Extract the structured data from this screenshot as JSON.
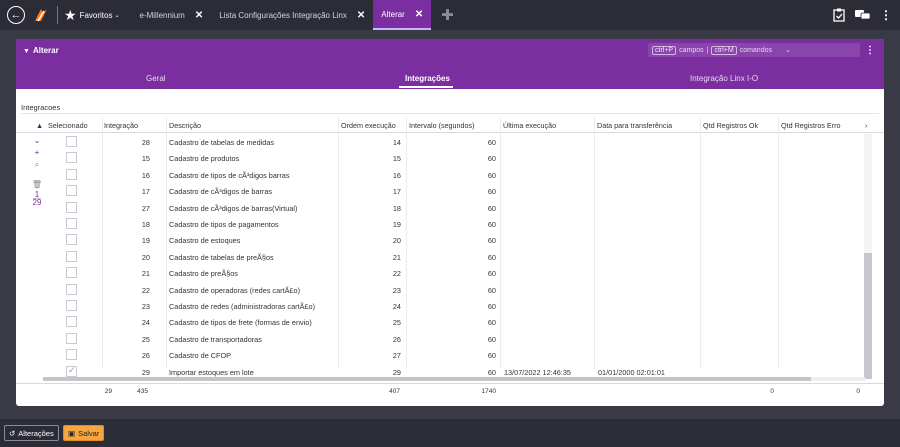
{
  "topbar": {
    "favorites_label": "Favoritos",
    "tabs": [
      {
        "label": "e-Millennium",
        "close": "✕"
      },
      {
        "label": "Lista Configurações Integração Linx",
        "close": "✕"
      },
      {
        "label": "Alterar",
        "close": "✕",
        "active": true
      }
    ]
  },
  "panel": {
    "title": "Alterar",
    "shortcut1_key": "ctrl+P",
    "shortcut1_label": "campos",
    "shortcut_separator": "|",
    "shortcut2_key": "ctrl+M",
    "shortcut2_label": "comandos",
    "tabs": [
      {
        "label": "Geral"
      },
      {
        "label": "Integrações",
        "active": true
      },
      {
        "label": "Integração Linx I-O"
      }
    ],
    "section_label": "Integracoes"
  },
  "grid": {
    "columns": [
      "Selecionado",
      "Integração",
      "Descrição",
      "Ordem execução",
      "Intervalo (segundos)",
      "Última execução",
      "Data para transferência",
      "Qtd Registros Ok",
      "Qtd Registros Erro"
    ],
    "sidebar_counter_top": "1",
    "sidebar_counter_bottom": "29",
    "rows": [
      {
        "checked": false,
        "integracao": "28",
        "descricao": "Cadastro de tabelas de medidas",
        "ordem": "14",
        "intervalo": "60",
        "ultima": "",
        "data_transf": ""
      },
      {
        "checked": false,
        "integracao": "15",
        "descricao": "Cadastro de produtos",
        "ordem": "15",
        "intervalo": "60",
        "ultima": "",
        "data_transf": ""
      },
      {
        "checked": false,
        "integracao": "16",
        "descricao": "Cadastro de tipos de cÃ³digos barras",
        "ordem": "16",
        "intervalo": "60",
        "ultima": "",
        "data_transf": ""
      },
      {
        "checked": false,
        "integracao": "17",
        "descricao": "Cadastro de cÃ³digos de barras",
        "ordem": "17",
        "intervalo": "60",
        "ultima": "",
        "data_transf": ""
      },
      {
        "checked": false,
        "integracao": "27",
        "descricao": "Cadastro de cÃ³digos de barras(Virtual)",
        "ordem": "18",
        "intervalo": "60",
        "ultima": "",
        "data_transf": ""
      },
      {
        "checked": false,
        "integracao": "18",
        "descricao": "Cadastro de tipos de pagamentos",
        "ordem": "19",
        "intervalo": "60",
        "ultima": "",
        "data_transf": ""
      },
      {
        "checked": false,
        "integracao": "19",
        "descricao": "Cadastro de estoques",
        "ordem": "20",
        "intervalo": "60",
        "ultima": "",
        "data_transf": ""
      },
      {
        "checked": false,
        "integracao": "20",
        "descricao": "Cadastro de tabelas de preÃ§os",
        "ordem": "21",
        "intervalo": "60",
        "ultima": "",
        "data_transf": ""
      },
      {
        "checked": false,
        "integracao": "21",
        "descricao": "Cadastro de preÃ§os",
        "ordem": "22",
        "intervalo": "60",
        "ultima": "",
        "data_transf": ""
      },
      {
        "checked": false,
        "integracao": "22",
        "descricao": "Cadastro de operadoras (redes cartÃ£o)",
        "ordem": "23",
        "intervalo": "60",
        "ultima": "",
        "data_transf": ""
      },
      {
        "checked": false,
        "integracao": "23",
        "descricao": "Cadastro de redes (administradoras cartÃ£o)",
        "ordem": "24",
        "intervalo": "60",
        "ultima": "",
        "data_transf": ""
      },
      {
        "checked": false,
        "integracao": "24",
        "descricao": "Cadastro de tipos de frete (formas de envio)",
        "ordem": "25",
        "intervalo": "60",
        "ultima": "",
        "data_transf": ""
      },
      {
        "checked": false,
        "integracao": "25",
        "descricao": "Cadastro de transportadoras",
        "ordem": "26",
        "intervalo": "60",
        "ultima": "",
        "data_transf": ""
      },
      {
        "checked": false,
        "integracao": "26",
        "descricao": "Cadastro de CFOP",
        "ordem": "27",
        "intervalo": "60",
        "ultima": "",
        "data_transf": ""
      },
      {
        "checked": true,
        "integracao": "29",
        "descricao": "Importar estoques em lote",
        "ordem": "29",
        "intervalo": "60",
        "ultima": "13/07/2022 12:46:35",
        "data_transf": "01/01/2000 02:01:01"
      }
    ],
    "footer": {
      "selecionado": "29",
      "integracao": "435",
      "ordem": "407",
      "intervalo": "1740",
      "qtd_ok": "0",
      "qtd_erro": "0"
    }
  },
  "bottombar": {
    "changes_label": "Alterações",
    "save_label": "Salvar"
  },
  "colors": {
    "accent": "#7b2ea0",
    "save_button": "#f5a640",
    "topbar": "#2c2c37"
  }
}
